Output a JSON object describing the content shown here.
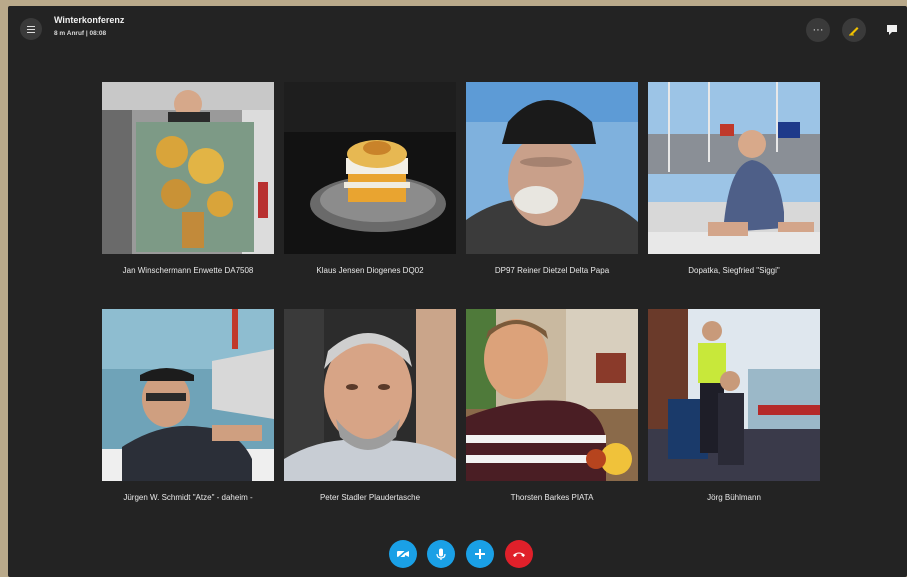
{
  "header": {
    "title": "Winterkonferenz",
    "subtitle": "8 m Anruf | 08:08"
  },
  "participants": [
    {
      "name": "Jan Winschermann Enwette DA7508"
    },
    {
      "name": "Klaus Jensen Diogenes DQ02"
    },
    {
      "name": "DP97 Reiner Dietzel Delta Papa"
    },
    {
      "name": "Dopatka, Siegfried \"Siggi\""
    },
    {
      "name": "Jürgen W. Schmidt \"Atze\" - daheim -"
    },
    {
      "name": "Peter Stadler Plaudertasche"
    },
    {
      "name": "Thorsten Barkes PIATA"
    },
    {
      "name": "Jörg Bühlmann"
    }
  ],
  "icons": {
    "menu": "menu-icon",
    "more": "more-icon",
    "highlight": "highlight-icon",
    "chat": "chat-icon",
    "video": "video-icon",
    "mic": "mic-icon",
    "add": "add-icon",
    "hangup": "hangup-icon"
  },
  "colors": {
    "accent": "#1aa0e6",
    "hangup": "#e0202a",
    "background": "#232323"
  }
}
